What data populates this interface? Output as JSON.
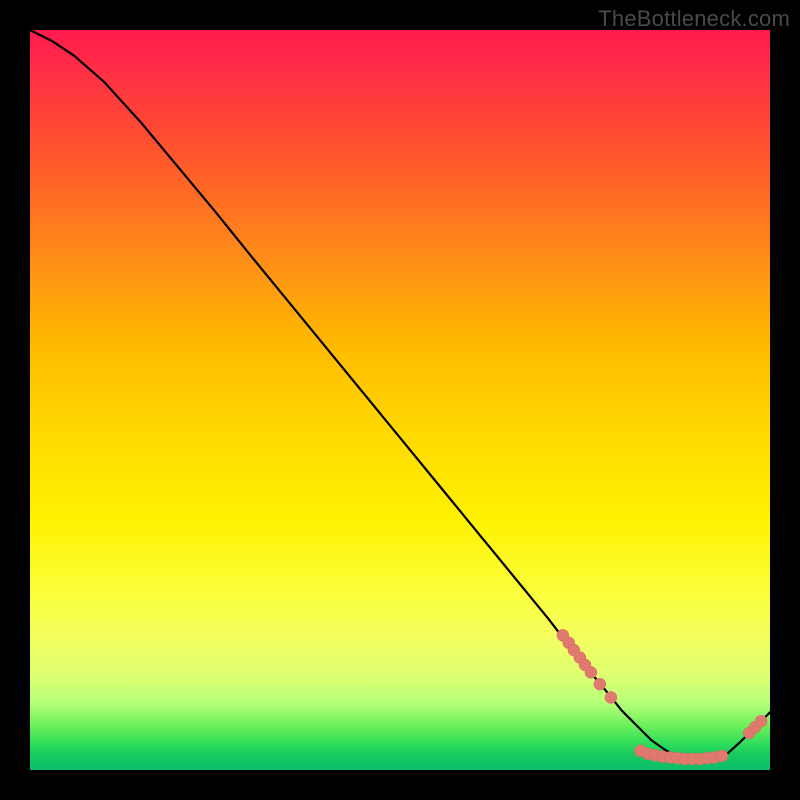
{
  "watermark": "TheBottleneck.com",
  "colors": {
    "curve_stroke": "#000000",
    "dot_fill": "#e07a6e",
    "dot_stroke": "#d86a5e"
  },
  "chart_data": {
    "type": "line",
    "title": "",
    "xlabel": "",
    "ylabel": "",
    "xlim": [
      0,
      100
    ],
    "ylim": [
      0,
      100
    ],
    "curve": {
      "x": [
        0,
        3,
        6,
        10,
        15,
        20,
        25,
        30,
        35,
        40,
        45,
        50,
        55,
        60,
        65,
        70,
        74,
        78,
        80,
        82,
        84,
        86,
        88,
        90,
        92,
        94,
        96,
        98,
        100
      ],
      "y": [
        100,
        98.5,
        96.5,
        93,
        87.5,
        81.5,
        75.5,
        69.3,
        63.2,
        57.1,
        51.0,
        44.9,
        38.8,
        32.7,
        26.6,
        20.5,
        15.3,
        10.5,
        8.0,
        6.0,
        4.0,
        2.6,
        1.8,
        1.5,
        1.5,
        2.0,
        3.8,
        5.8,
        7.8
      ]
    },
    "dot_clusters": [
      {
        "segment": "descent",
        "points": [
          {
            "x": 72.0,
            "y": 18.2
          },
          {
            "x": 72.8,
            "y": 17.2
          },
          {
            "x": 73.5,
            "y": 16.2
          },
          {
            "x": 74.3,
            "y": 15.2
          },
          {
            "x": 75.0,
            "y": 14.2
          },
          {
            "x": 75.8,
            "y": 13.2
          },
          {
            "x": 77.0,
            "y": 11.6
          },
          {
            "x": 78.5,
            "y": 9.8
          }
        ]
      },
      {
        "segment": "valley",
        "points": [
          {
            "x": 82.5,
            "y": 2.6
          },
          {
            "x": 83.5,
            "y": 2.2
          },
          {
            "x": 84.5,
            "y": 2.0
          },
          {
            "x": 85.5,
            "y": 1.8
          },
          {
            "x": 86.5,
            "y": 1.7
          },
          {
            "x": 87.5,
            "y": 1.6
          },
          {
            "x": 88.5,
            "y": 1.5
          },
          {
            "x": 89.5,
            "y": 1.5
          },
          {
            "x": 90.5,
            "y": 1.5
          },
          {
            "x": 91.5,
            "y": 1.6
          },
          {
            "x": 92.5,
            "y": 1.7
          },
          {
            "x": 93.5,
            "y": 1.9
          }
        ]
      },
      {
        "segment": "rise",
        "points": [
          {
            "x": 97.2,
            "y": 5.0
          },
          {
            "x": 98.0,
            "y": 5.8
          },
          {
            "x": 98.8,
            "y": 6.6
          }
        ]
      }
    ]
  }
}
